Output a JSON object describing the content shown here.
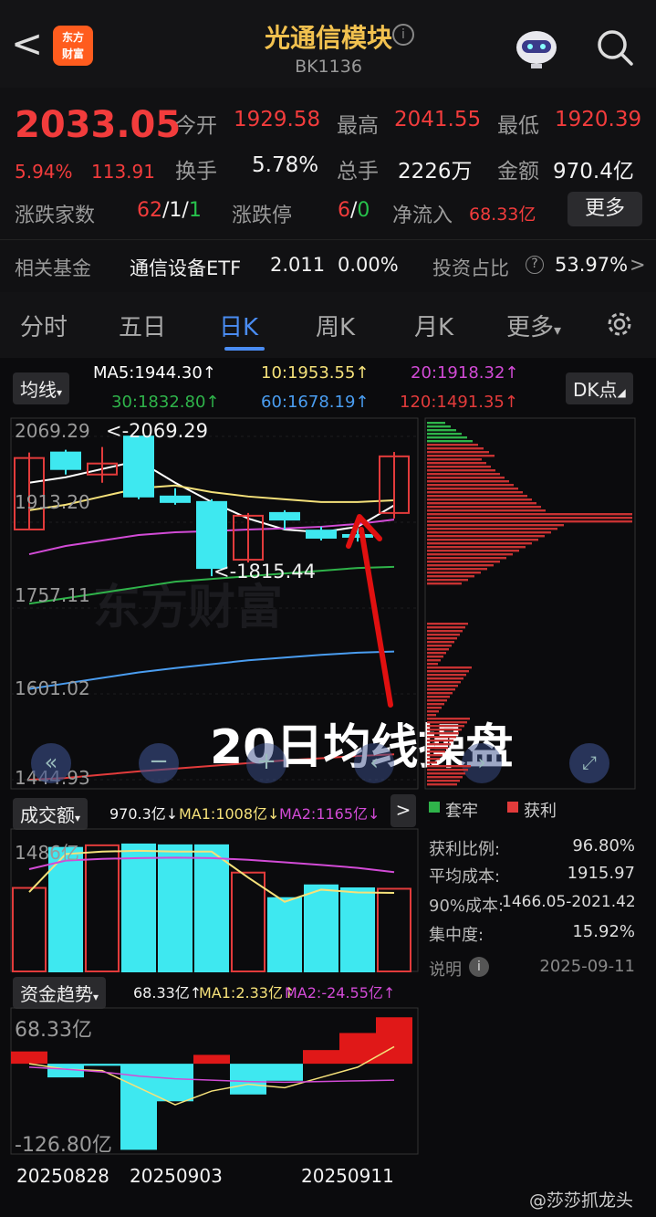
{
  "header": {
    "back": "<",
    "logo": "东方\n财富",
    "title": "光通信模块",
    "code": "BK1136"
  },
  "quote": {
    "price": "2033.05",
    "change_pct": "5.94%",
    "change_amt": "113.91",
    "open_label": "今开",
    "open": "1929.58",
    "high_label": "最高",
    "high": "2041.55",
    "low_label": "最低",
    "low": "1920.39",
    "turnover_label": "换手",
    "turnover": "5.78%",
    "volume_label": "总手",
    "volume": "2226万",
    "amount_label": "金额",
    "amount": "970.4亿",
    "updown_label": "涨跌家数",
    "up": "62",
    "flat": "1",
    "down": "1",
    "slash": "/",
    "limit_label": "涨跌停",
    "limit_up": "6",
    "limit_down": "0",
    "netflow_label": "净流入",
    "netflow": "68.33亿",
    "more_label": "更多",
    "fund_label": "相关基金",
    "fund_name": "通信设备ETF",
    "fund_price": "2.011",
    "fund_pct": "0.00%",
    "invest_label": "投资占比",
    "invest_pct": "53.97%",
    "invest_arrow": ">",
    "question": "?"
  },
  "tabs": [
    "分时",
    "五日",
    "日K",
    "周K",
    "月K",
    "更多"
  ],
  "tab_more_arrow": "▾",
  "indicators": {
    "ma_button": "均线",
    "ma5": "MA5:1944.30↑",
    "ma10": "10:1953.55↑",
    "ma20": "20:1918.32↑",
    "ma30": "30:1832.80↑",
    "ma60": "60:1678.19↑",
    "ma120": "120:1491.35↑",
    "dk_button": "DK点",
    "colors": {
      "ma5": "#ffffff",
      "ma10": "#f5e17a",
      "ma20": "#d24bd6",
      "ma30": "#2fb34a",
      "ma60": "#4a9df0",
      "ma120": "#e23b3b"
    }
  },
  "kline": {
    "price_ticks": [
      "2069.29",
      "1913.20",
      "1757.11",
      "1601.02",
      "1444.93"
    ],
    "high_marker": "<-2069.29",
    "low_marker": "<-1815.44",
    "annotation": "20日均线操盘",
    "watermark": "东方财富"
  },
  "volume": {
    "button": "成交额",
    "value": "970.3亿↓",
    "ma1": "MA1:1008亿↓",
    "ma2": "MA2:1165亿↓",
    "tick": "1486亿",
    "expand": ">"
  },
  "fund": {
    "button": "资金趋势",
    "value": "68.33亿↑",
    "ma1": "MA1:2.33亿↑",
    "ma2": "MA2:-24.55亿↑",
    "tick_top": "68.33亿",
    "tick_bottom": "-126.80亿"
  },
  "dates": [
    "20250828",
    "20250903",
    "20250911"
  ],
  "chip": {
    "legend_trapped": "套牢",
    "legend_profit": "获利",
    "rows": [
      {
        "label": "获利比例:",
        "value": "96.80%"
      },
      {
        "label": "平均成本:",
        "value": "1915.97"
      },
      {
        "label": "90%成本:",
        "value": "1466.05-2021.42"
      },
      {
        "label": "集中度:",
        "value": "15.92%"
      }
    ],
    "explain": "说明",
    "date": "2025-09-11"
  },
  "watermark_user": "@莎莎抓龙头",
  "chart_data": {
    "type": "candlestick",
    "candles": [
      {
        "o": 1900,
        "c": 2030,
        "h": 2040,
        "l": 1900,
        "up": true
      },
      {
        "o": 2040,
        "c": 2010,
        "h": 2045,
        "l": 2000,
        "up": false
      },
      {
        "o": 2000,
        "c": 2020,
        "h": 2050,
        "l": 1985,
        "up": true
      },
      {
        "o": 2069,
        "c": 1960,
        "h": 2069,
        "l": 1955,
        "up": false
      },
      {
        "o": 1960,
        "c": 1950,
        "h": 1975,
        "l": 1945,
        "up": false
      },
      {
        "o": 1950,
        "c": 1830,
        "h": 1955,
        "l": 1815,
        "up": false
      },
      {
        "o": 1845,
        "c": 1925,
        "h": 1930,
        "l": 1840,
        "up": true
      },
      {
        "o": 1930,
        "c": 1918,
        "h": 1935,
        "l": 1900,
        "up": false
      },
      {
        "o": 1898,
        "c": 1885,
        "h": 1905,
        "l": 1880,
        "up": false
      },
      {
        "o": 1890,
        "c": 1888,
        "h": 1905,
        "l": 1878,
        "up": false
      },
      {
        "o": 1930,
        "c": 2033,
        "h": 2041,
        "l": 1920,
        "up": true
      }
    ],
    "volume": [
      980,
      1450,
      1480,
      1490,
      1480,
      1480,
      1160,
      860,
      1010,
      975,
      970
    ],
    "fund_flow": [
      18,
      -20,
      -3,
      -126,
      -55,
      13,
      -45,
      -25,
      20,
      45,
      68
    ],
    "ylim": [
      1444.93,
      2069.29
    ]
  }
}
